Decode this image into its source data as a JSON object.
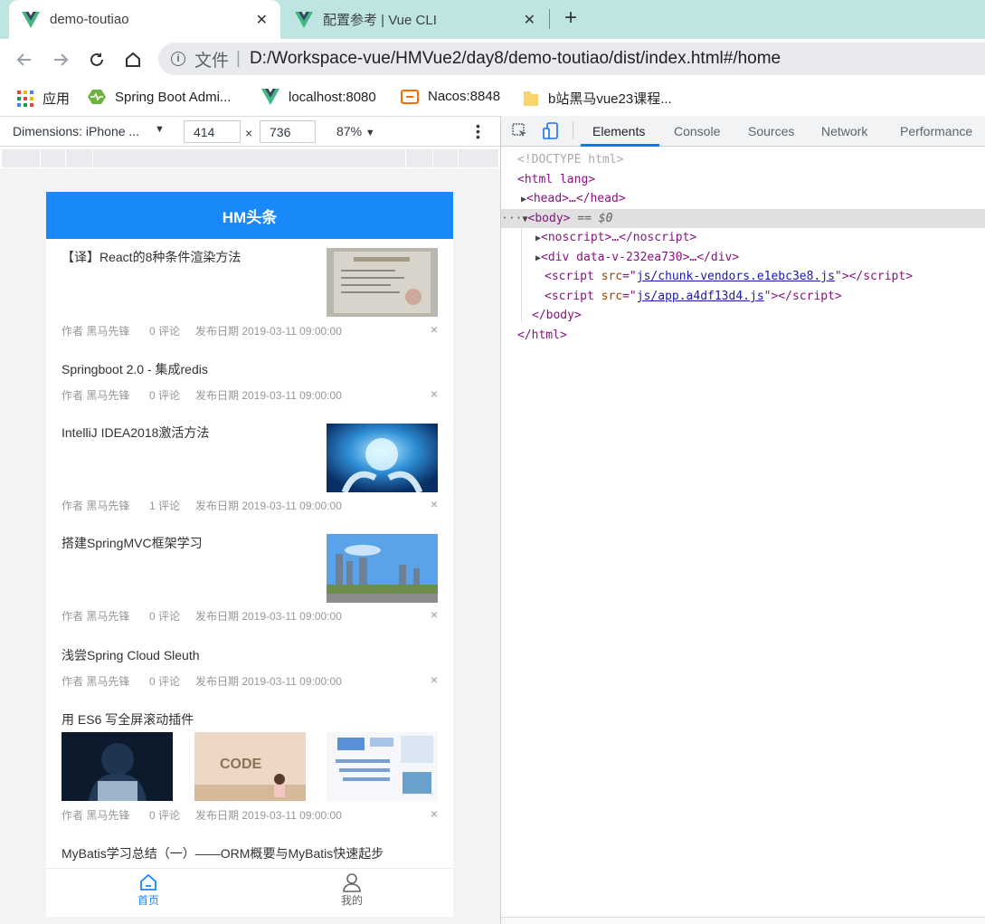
{
  "browser": {
    "tabs": [
      {
        "title": "demo-toutiao",
        "active": true
      },
      {
        "title": "配置参考 | Vue CLI",
        "active": false
      }
    ],
    "address": {
      "scheme_label": "文件",
      "url": "D:/Workspace-vue/HMVue2/day8/demo-toutiao/dist/index.html#/home"
    },
    "bookmarks": [
      {
        "label": "应用",
        "icon": "apps-grid-icon"
      },
      {
        "label": "Spring Boot Admi...",
        "icon": "spring-boot-admin-icon"
      },
      {
        "label": "localhost:8080",
        "icon": "vue-logo-icon"
      },
      {
        "label": "Nacos:8848",
        "icon": "nacos-icon"
      },
      {
        "label": "b站黑马vue23课程...",
        "icon": "folder-icon"
      }
    ]
  },
  "device_toolbar": {
    "dimensions_label": "Dimensions: iPhone ...",
    "width": "414",
    "height": "736",
    "times": "×",
    "zoom": "87%"
  },
  "app": {
    "title": "HM头条",
    "articles": [
      {
        "title": "【译】React的8种条件渲染方法",
        "author": "作者 黑马先锋",
        "comments": "0 评论",
        "date": "发布日期 2019-03-11 09:00:00",
        "images": [
          "certificate-photo"
        ]
      },
      {
        "title": "Springboot 2.0 - 集成redis",
        "author": "作者 黑马先锋",
        "comments": "0 评论",
        "date": "发布日期 2019-03-11 09:00:00",
        "images": []
      },
      {
        "title": "IntelliJ IDEA2018激活方法",
        "author": "作者 黑马先锋",
        "comments": "1 评论",
        "date": "发布日期 2019-03-11 09:00:00",
        "images": [
          "globe-hands-photo"
        ]
      },
      {
        "title": "搭建SpringMVC框架学习",
        "author": "作者 黑马先锋",
        "comments": "0 评论",
        "date": "发布日期 2019-03-11 09:00:00",
        "images": [
          "city-skyline-photo"
        ]
      },
      {
        "title": "浅尝Spring Cloud Sleuth",
        "author": "作者 黑马先锋",
        "comments": "0 评论",
        "date": "发布日期 2019-03-11 09:00:00",
        "images": []
      },
      {
        "title": "用 ES6 写全屏滚动插件",
        "author": "作者 黑马先锋",
        "comments": "0 评论",
        "date": "发布日期 2019-03-11 09:00:00",
        "images": [
          "hacker-photo",
          "code-photo",
          "diagram-photo"
        ]
      },
      {
        "title": "MyBatis学习总结（一）——ORM概要与MyBatis快速起步"
      }
    ],
    "close_glyph": "×",
    "tabbar": [
      {
        "label": "首页",
        "icon": "home-icon",
        "active": true,
        "color": "#1989fa"
      },
      {
        "label": "我的",
        "icon": "user-icon",
        "active": false,
        "color": "#646566"
      }
    ]
  },
  "devtools": {
    "tabs": [
      "Elements",
      "Console",
      "Sources",
      "Network",
      "Performance"
    ],
    "active_tab": "Elements",
    "dom": {
      "doctype": "<!DOCTYPE html>",
      "html_open": "<html lang>",
      "head": "<head>…</head>",
      "body_open": "<body>",
      "body_marker": "== $0",
      "noscript": "<noscript>…</noscript>",
      "div": "<div data-v-232ea730>…</div>",
      "script1_src": "js/chunk-vendors.e1ebc3e8.js",
      "script2_src": "js/app.a4df13d4.js",
      "body_close": "</body>",
      "html_close": "</html>"
    }
  },
  "colors": {
    "accent": "#1989fa",
    "tab_bg": "#bfe5e2"
  }
}
